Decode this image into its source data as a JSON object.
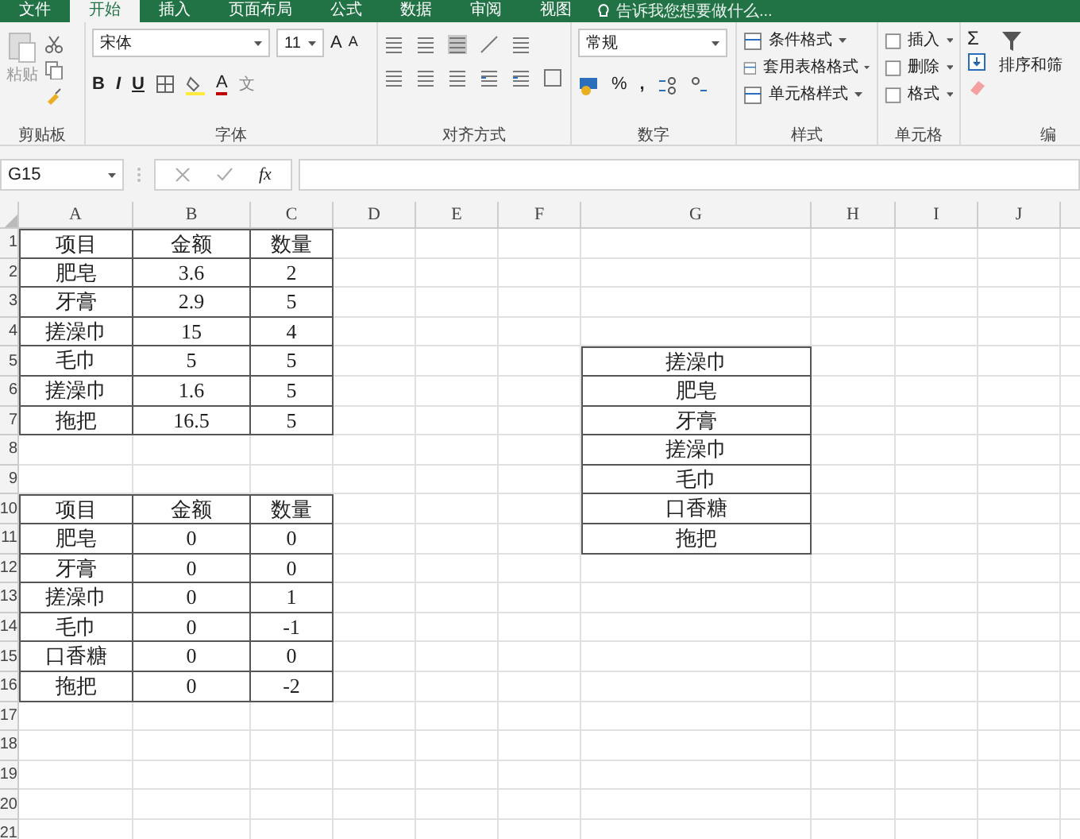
{
  "tabs": [
    {
      "label": "文件",
      "selected": false
    },
    {
      "label": "开始",
      "selected": true
    },
    {
      "label": "插入",
      "selected": false
    },
    {
      "label": "页面布局",
      "selected": false
    },
    {
      "label": "公式",
      "selected": false
    },
    {
      "label": "数据",
      "selected": false
    },
    {
      "label": "审阅",
      "selected": false
    },
    {
      "label": "视图",
      "selected": false
    }
  ],
  "tell_me": {
    "placeholder": "告诉我您想要做什么..."
  },
  "ribbon": [
    {
      "kind": "clipboard",
      "label": "剪贴板",
      "paste": "粘贴"
    },
    {
      "kind": "font",
      "label": "字体",
      "font_name": "宋体",
      "font_size": "11",
      "grow": "A",
      "shrink": "A",
      "bold": "B",
      "italic": "I",
      "underline": "U",
      "font_color": "A",
      "phonetic": "文"
    },
    {
      "kind": "alignment",
      "label": "对齐方式"
    },
    {
      "kind": "number",
      "label": "数字",
      "format": "常规",
      "percent": "%",
      "comma": ","
    },
    {
      "kind": "styles",
      "label": "样式",
      "items": [
        "条件格式",
        "套用表格格式",
        "单元格样式"
      ]
    },
    {
      "kind": "cells",
      "label": "单元格",
      "items": [
        "插入",
        "删除",
        "格式"
      ]
    },
    {
      "kind": "editing",
      "label": "编",
      "sum": "Σ",
      "sort": "排序和筛"
    }
  ],
  "formula_bar": {
    "name_box": "G15",
    "fx": "fx"
  },
  "columns": [
    "A",
    "B",
    "C",
    "D",
    "E",
    "F",
    "G",
    "H",
    "I",
    "J"
  ],
  "rows": [
    {
      "number": "1",
      "cells": [
        {
          "text": "项目",
          "bordered": true
        },
        {
          "text": "金额",
          "bordered": true
        },
        {
          "text": "数量",
          "bordered": true
        },
        {},
        {},
        {},
        {},
        {},
        {},
        {}
      ]
    },
    {
      "number": "2",
      "cells": [
        {
          "text": "肥皂",
          "bordered": true
        },
        {
          "text": "3.6",
          "bordered": true
        },
        {
          "text": "2",
          "bordered": true
        },
        {},
        {},
        {},
        {},
        {},
        {},
        {}
      ]
    },
    {
      "number": "3",
      "cells": [
        {
          "text": "牙膏",
          "bordered": true
        },
        {
          "text": "2.9",
          "bordered": true
        },
        {
          "text": "5",
          "bordered": true
        },
        {},
        {},
        {},
        {},
        {},
        {},
        {}
      ]
    },
    {
      "number": "4",
      "cells": [
        {
          "text": "搓澡巾",
          "bordered": true
        },
        {
          "text": "15",
          "bordered": true
        },
        {
          "text": "4",
          "bordered": true
        },
        {},
        {},
        {},
        {},
        {},
        {},
        {}
      ]
    },
    {
      "number": "5",
      "cells": [
        {
          "text": "毛巾",
          "bordered": true
        },
        {
          "text": "5",
          "bordered": true
        },
        {
          "text": "5",
          "bordered": true
        },
        {},
        {},
        {},
        {
          "text": "搓澡巾",
          "bordered": true
        },
        {},
        {},
        {}
      ]
    },
    {
      "number": "6",
      "cells": [
        {
          "text": "搓澡巾",
          "bordered": true
        },
        {
          "text": "1.6",
          "bordered": true
        },
        {
          "text": "5",
          "bordered": true
        },
        {},
        {},
        {},
        {
          "text": "肥皂",
          "bordered": true
        },
        {},
        {},
        {}
      ]
    },
    {
      "number": "7",
      "cells": [
        {
          "text": "拖把",
          "bordered": true
        },
        {
          "text": "16.5",
          "bordered": true
        },
        {
          "text": "5",
          "bordered": true
        },
        {},
        {},
        {},
        {
          "text": "牙膏",
          "bordered": true
        },
        {},
        {},
        {}
      ]
    },
    {
      "number": "8",
      "cells": [
        {},
        {},
        {},
        {},
        {},
        {},
        {
          "text": "搓澡巾",
          "bordered": true
        },
        {},
        {},
        {}
      ]
    },
    {
      "number": "9",
      "cells": [
        {},
        {},
        {},
        {},
        {},
        {},
        {
          "text": "毛巾",
          "bordered": true
        },
        {},
        {},
        {}
      ]
    },
    {
      "number": "10",
      "cells": [
        {
          "text": "项目",
          "bordered": true
        },
        {
          "text": "金额",
          "bordered": true
        },
        {
          "text": "数量",
          "bordered": true
        },
        {},
        {},
        {},
        {
          "text": "口香糖",
          "bordered": true
        },
        {},
        {},
        {}
      ]
    },
    {
      "number": "11",
      "cells": [
        {
          "text": "肥皂",
          "bordered": true
        },
        {
          "text": "0",
          "bordered": true
        },
        {
          "text": "0",
          "bordered": true
        },
        {},
        {},
        {},
        {
          "text": "拖把",
          "bordered": true
        },
        {},
        {},
        {}
      ]
    },
    {
      "number": "12",
      "cells": [
        {
          "text": "牙膏",
          "bordered": true
        },
        {
          "text": "0",
          "bordered": true
        },
        {
          "text": "0",
          "bordered": true
        },
        {},
        {},
        {},
        {},
        {},
        {},
        {}
      ]
    },
    {
      "number": "13",
      "cells": [
        {
          "text": "搓澡巾",
          "bordered": true
        },
        {
          "text": "0",
          "bordered": true
        },
        {
          "text": "1",
          "bordered": true
        },
        {},
        {},
        {},
        {},
        {},
        {},
        {}
      ]
    },
    {
      "number": "14",
      "cells": [
        {
          "text": "毛巾",
          "bordered": true
        },
        {
          "text": "0",
          "bordered": true
        },
        {
          "text": "-1",
          "bordered": true
        },
        {},
        {},
        {},
        {},
        {},
        {},
        {}
      ]
    },
    {
      "number": "15",
      "cells": [
        {
          "text": "口香糖",
          "bordered": true
        },
        {
          "text": "0",
          "bordered": true
        },
        {
          "text": "0",
          "bordered": true
        },
        {},
        {},
        {},
        {},
        {},
        {},
        {}
      ]
    },
    {
      "number": "16",
      "cells": [
        {
          "text": "拖把",
          "bordered": true
        },
        {
          "text": "0",
          "bordered": true
        },
        {
          "text": "-2",
          "bordered": true
        },
        {},
        {},
        {},
        {},
        {},
        {},
        {}
      ]
    },
    {
      "number": "17",
      "cells": [
        {},
        {},
        {},
        {},
        {},
        {},
        {},
        {},
        {},
        {}
      ]
    },
    {
      "number": "18",
      "cells": [
        {},
        {},
        {},
        {},
        {},
        {},
        {},
        {},
        {},
        {}
      ]
    },
    {
      "number": "19",
      "cells": [
        {},
        {},
        {},
        {},
        {},
        {},
        {},
        {},
        {},
        {}
      ]
    },
    {
      "number": "20",
      "cells": [
        {},
        {},
        {},
        {},
        {},
        {},
        {},
        {},
        {},
        {}
      ]
    },
    {
      "number": "21",
      "cells": [
        {},
        {},
        {},
        {},
        {},
        {},
        {},
        {},
        {},
        {}
      ]
    }
  ]
}
